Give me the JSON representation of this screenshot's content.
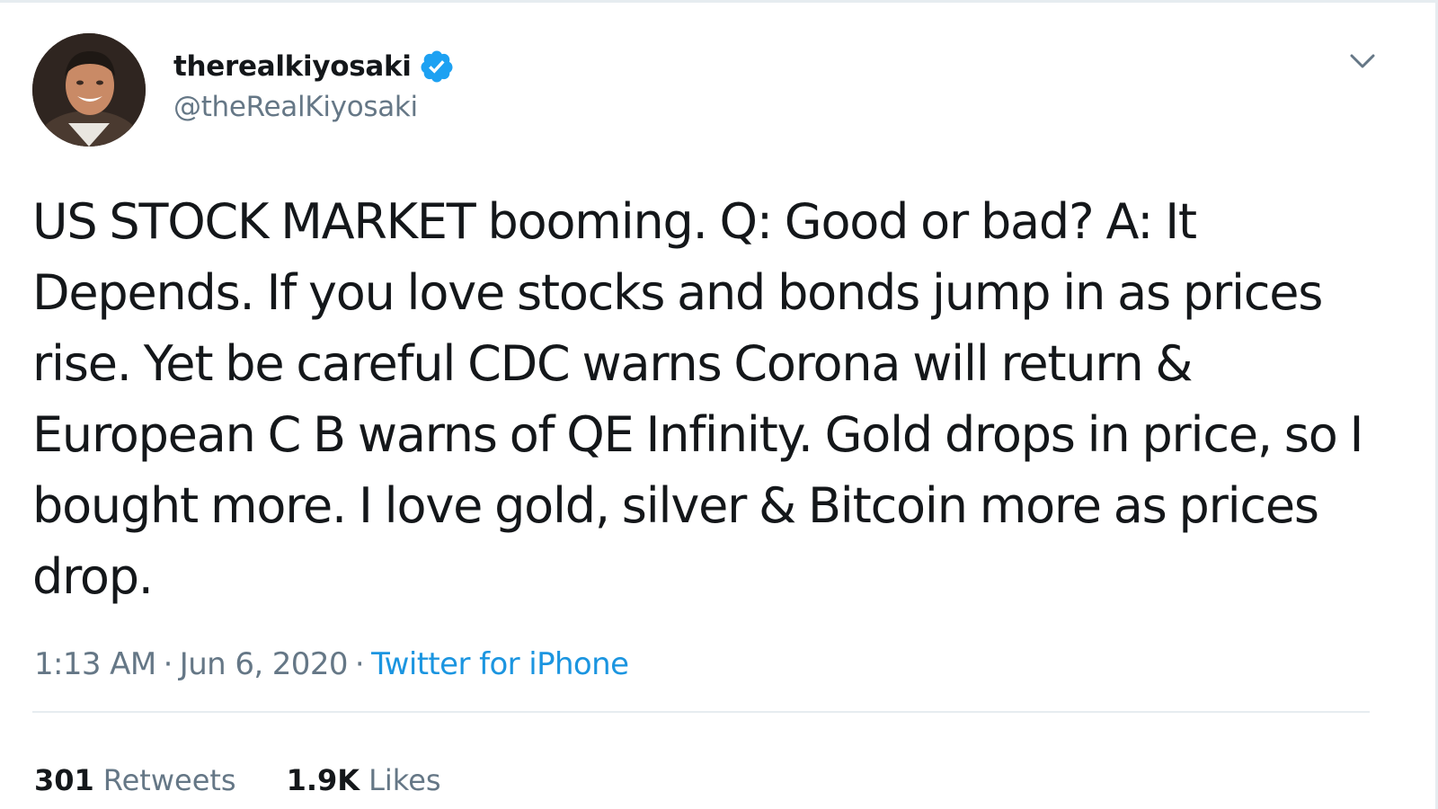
{
  "tweet": {
    "display_name": "therealkiyosaki",
    "handle": "@theRealKiyosaki",
    "text": "US STOCK MARKET booming. Q: Good or bad? A: It Depends. If you love stocks and bonds jump in as prices rise. Yet be careful CDC warns Corona will return & European C B warns of QE Infinity. Gold drops in price, so I bought more. I love gold, silver & Bitcoin more as prices drop.",
    "time": "1:13 AM",
    "separator": "·",
    "date": "Jun 6, 2020",
    "source": "Twitter for iPhone"
  },
  "stats": {
    "retweets_count": "301",
    "retweets_label": "Retweets",
    "likes_count": "1.9K",
    "likes_label": "Likes"
  },
  "icons": {
    "verified": "verified-badge-icon",
    "caret": "chevron-down-icon"
  },
  "colors": {
    "accent": "#1b95e0",
    "secondary_text": "#657786",
    "primary_text": "#14171a",
    "divider": "#e6ecf0"
  }
}
